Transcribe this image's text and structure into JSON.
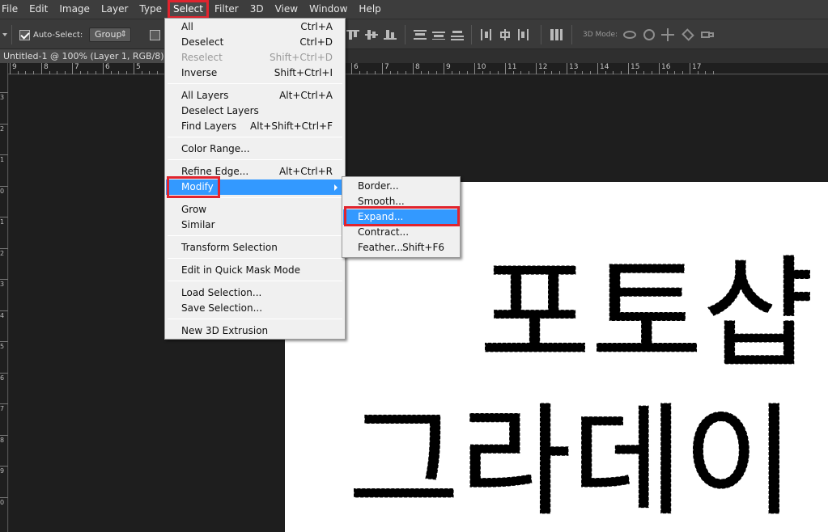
{
  "menubar": {
    "items": [
      "File",
      "Edit",
      "Image",
      "Layer",
      "Type",
      "Select",
      "Filter",
      "3D",
      "View",
      "Window",
      "Help"
    ],
    "active": "Select"
  },
  "options": {
    "auto_select_label": "Auto-Select:",
    "auto_select_checked": true,
    "group_value": "Group",
    "mode_3d_label": "3D Mode:"
  },
  "document": {
    "tab_title": "Untitled-1 @ 100% (Layer 1, RGB/8) *"
  },
  "ruler": {
    "top_labels": [
      "9",
      "8",
      "7",
      "6",
      "5",
      "5",
      "6",
      "7",
      "8",
      "9",
      "10",
      "11",
      "12",
      "13",
      "14",
      "15",
      "16",
      "17"
    ],
    "left_labels": [
      "3",
      "2",
      "1",
      "0",
      "1",
      "2",
      "3",
      "4",
      "5",
      "6",
      "7",
      "8",
      "9",
      "0"
    ]
  },
  "select_menu": {
    "items": [
      {
        "label": "All",
        "shortcut": "Ctrl+A"
      },
      {
        "label": "Deselect",
        "shortcut": "Ctrl+D"
      },
      {
        "label": "Reselect",
        "shortcut": "Shift+Ctrl+D",
        "disabled": true
      },
      {
        "label": "Inverse",
        "shortcut": "Shift+Ctrl+I"
      },
      {
        "label": "All Layers",
        "shortcut": "Alt+Ctrl+A"
      },
      {
        "label": "Deselect Layers",
        "shortcut": ""
      },
      {
        "label": "Find Layers",
        "shortcut": "Alt+Shift+Ctrl+F"
      },
      {
        "label": "Color Range...",
        "shortcut": ""
      },
      {
        "label": "Refine Edge...",
        "shortcut": "Alt+Ctrl+R"
      },
      {
        "label": "Modify",
        "shortcut": "",
        "submenu": true,
        "highlighted": true
      },
      {
        "label": "Grow",
        "shortcut": ""
      },
      {
        "label": "Similar",
        "shortcut": ""
      },
      {
        "label": "Transform Selection",
        "shortcut": ""
      },
      {
        "label": "Edit in Quick Mask Mode",
        "shortcut": ""
      },
      {
        "label": "Load Selection...",
        "shortcut": ""
      },
      {
        "label": "Save Selection...",
        "shortcut": ""
      },
      {
        "label": "New 3D Extrusion",
        "shortcut": ""
      }
    ]
  },
  "modify_submenu": {
    "items": [
      {
        "label": "Border...",
        "shortcut": ""
      },
      {
        "label": "Smooth...",
        "shortcut": ""
      },
      {
        "label": "Expand...",
        "shortcut": "",
        "highlighted": true
      },
      {
        "label": "Contract...",
        "shortcut": ""
      },
      {
        "label": "Feather...",
        "shortcut": "Shift+F6"
      }
    ]
  },
  "canvas": {
    "line1": "포토샵",
    "line2": "그라데이",
    "text_color": "#000000",
    "background": "#ffffff"
  },
  "colors": {
    "highlight": "#3399ff",
    "callout": "#e0242e"
  }
}
